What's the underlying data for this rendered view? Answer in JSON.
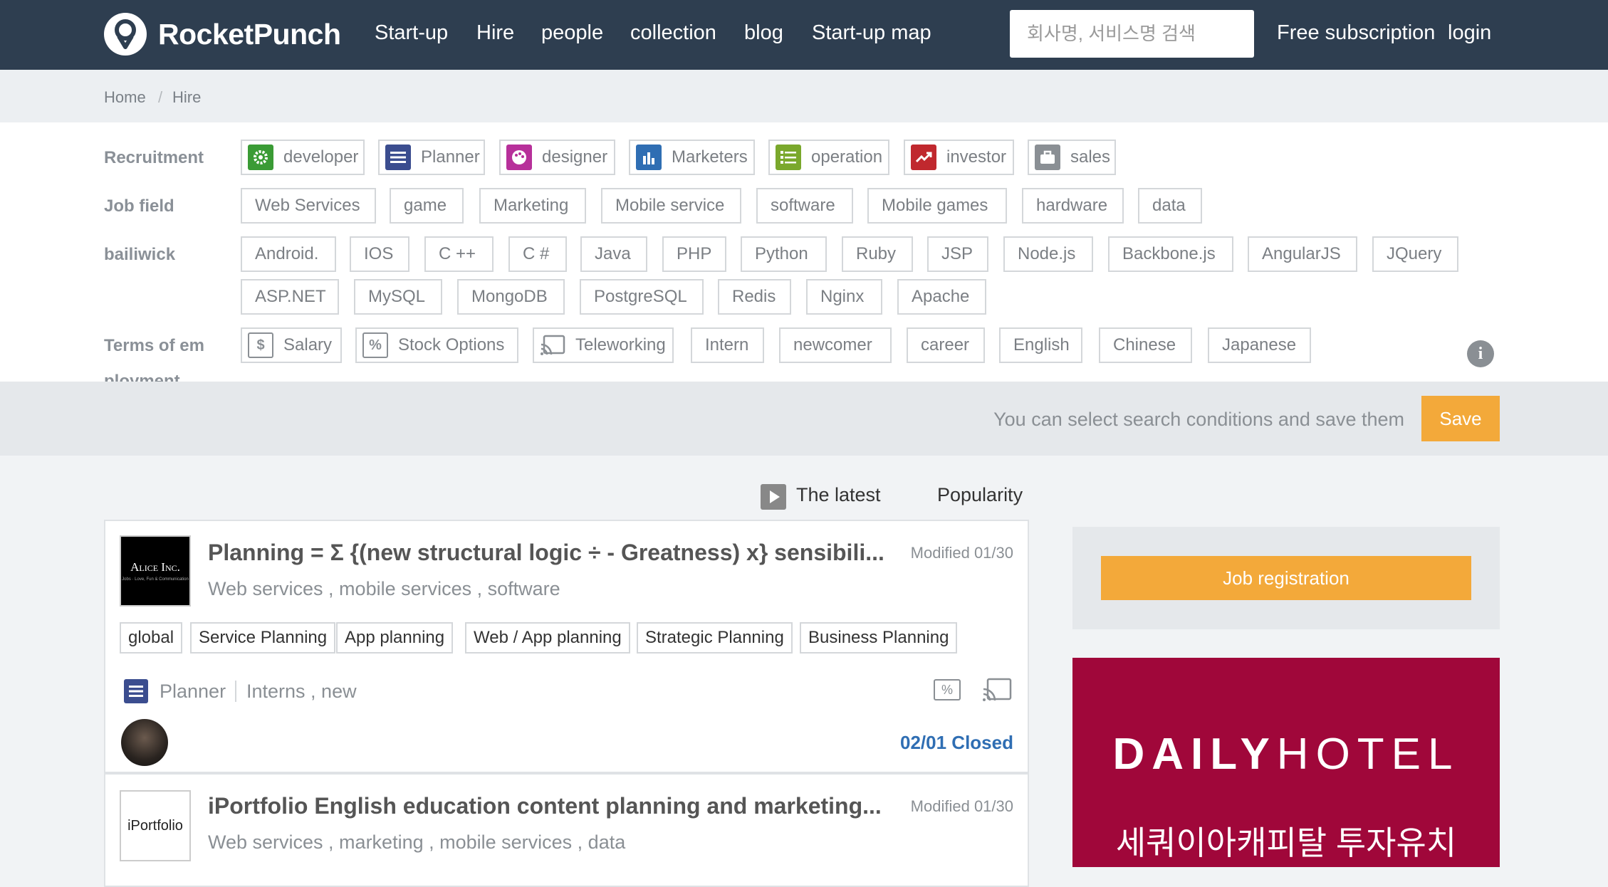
{
  "nav": {
    "logo_text": "RocketPunch",
    "items": [
      "Start-up",
      "Hire",
      "people",
      "collection",
      "blog",
      "Start-up map"
    ],
    "search_placeholder": "회사명, 서비스명 검색",
    "subscription": "Free subscription",
    "login": "login"
  },
  "breadcrumb": {
    "home": "Home",
    "separator": "/",
    "current": "Hire"
  },
  "filters": {
    "recruitment": {
      "label": "Recruitment",
      "options": [
        {
          "label": "developer",
          "icon": "gear-icon",
          "color": "#3a9b35"
        },
        {
          "label": "Planner",
          "icon": "list-icon",
          "color": "#3b4d8f"
        },
        {
          "label": "designer",
          "icon": "palette-icon",
          "color": "#b7309a"
        },
        {
          "label": "Marketers",
          "icon": "bar-chart-icon",
          "color": "#2f6eb3"
        },
        {
          "label": "operation",
          "icon": "checklist-icon",
          "color": "#7aa82c"
        },
        {
          "label": "investor",
          "icon": "trend-icon",
          "color": "#c0282e"
        },
        {
          "label": "sales",
          "icon": "briefcase-icon",
          "color": "#8a8f94"
        }
      ]
    },
    "job_field": {
      "label": "Job field",
      "options": [
        "Web Services",
        "game",
        "Marketing",
        "Mobile service",
        "software",
        "Mobile games",
        "hardware",
        "data"
      ]
    },
    "bailiwick": {
      "label": "bailiwick",
      "options": [
        "Android.",
        "IOS",
        "C ++",
        "C #",
        "Java",
        "PHP",
        "Python",
        "Ruby",
        "JSP",
        "Node.js",
        "Backbone.js",
        "AngularJS",
        "JQuery",
        "ASP.NET",
        "MySQL",
        "MongoDB",
        "PostgreSQL",
        "Redis",
        "Nginx",
        "Apache"
      ]
    },
    "terms": {
      "label_line1": "Terms of em",
      "label_line2": "ployment",
      "options": [
        {
          "label": "Salary",
          "icon": "dollar-icon"
        },
        {
          "label": "Stock Options",
          "icon": "percent-icon"
        },
        {
          "label": "Teleworking",
          "icon": "cast-icon"
        },
        {
          "label": "Intern"
        },
        {
          "label": "newcomer"
        },
        {
          "label": "career"
        },
        {
          "label": "English"
        },
        {
          "label": "Chinese"
        },
        {
          "label": "Japanese"
        }
      ]
    }
  },
  "save_bar": {
    "hint": "You can select search conditions and save them",
    "button": "Save"
  },
  "sort": {
    "latest": "The latest",
    "popularity": "Popularity"
  },
  "jobs": [
    {
      "company_logo_text": "Alice Inc.",
      "company_logo_sub": "Jobs · Love, Fun & Communication",
      "title": "Planning = Σ {(new structural logic ÷ - Greatness) x} sensibili...",
      "modified": "Modified 01/30",
      "fields": "Web services , mobile services , software",
      "tags": [
        "global",
        "Service Planning",
        "App planning",
        "Web / App planning",
        "Strategic Planning",
        "Business Planning"
      ],
      "role": "Planner",
      "terms": "Interns , new",
      "deadline": "02/01 Closed"
    },
    {
      "company_logo_text": "iPortfolio",
      "title": "iPortfolio English education content planning and marketing...",
      "modified": "Modified 01/30",
      "fields": "Web services , marketing , mobile services , data"
    }
  ],
  "sidebar": {
    "job_registration": "Job registration",
    "ad_brand_a": "DAILY",
    "ad_brand_b": "HOTEL",
    "ad_subtitle": "세쿼이아캐피탈 투자유치"
  },
  "colors": {
    "nav_bg": "#2e3e50",
    "accent": "#f3a93a",
    "deadline": "#2f6eb3",
    "ad_bg": "#a0073a"
  }
}
